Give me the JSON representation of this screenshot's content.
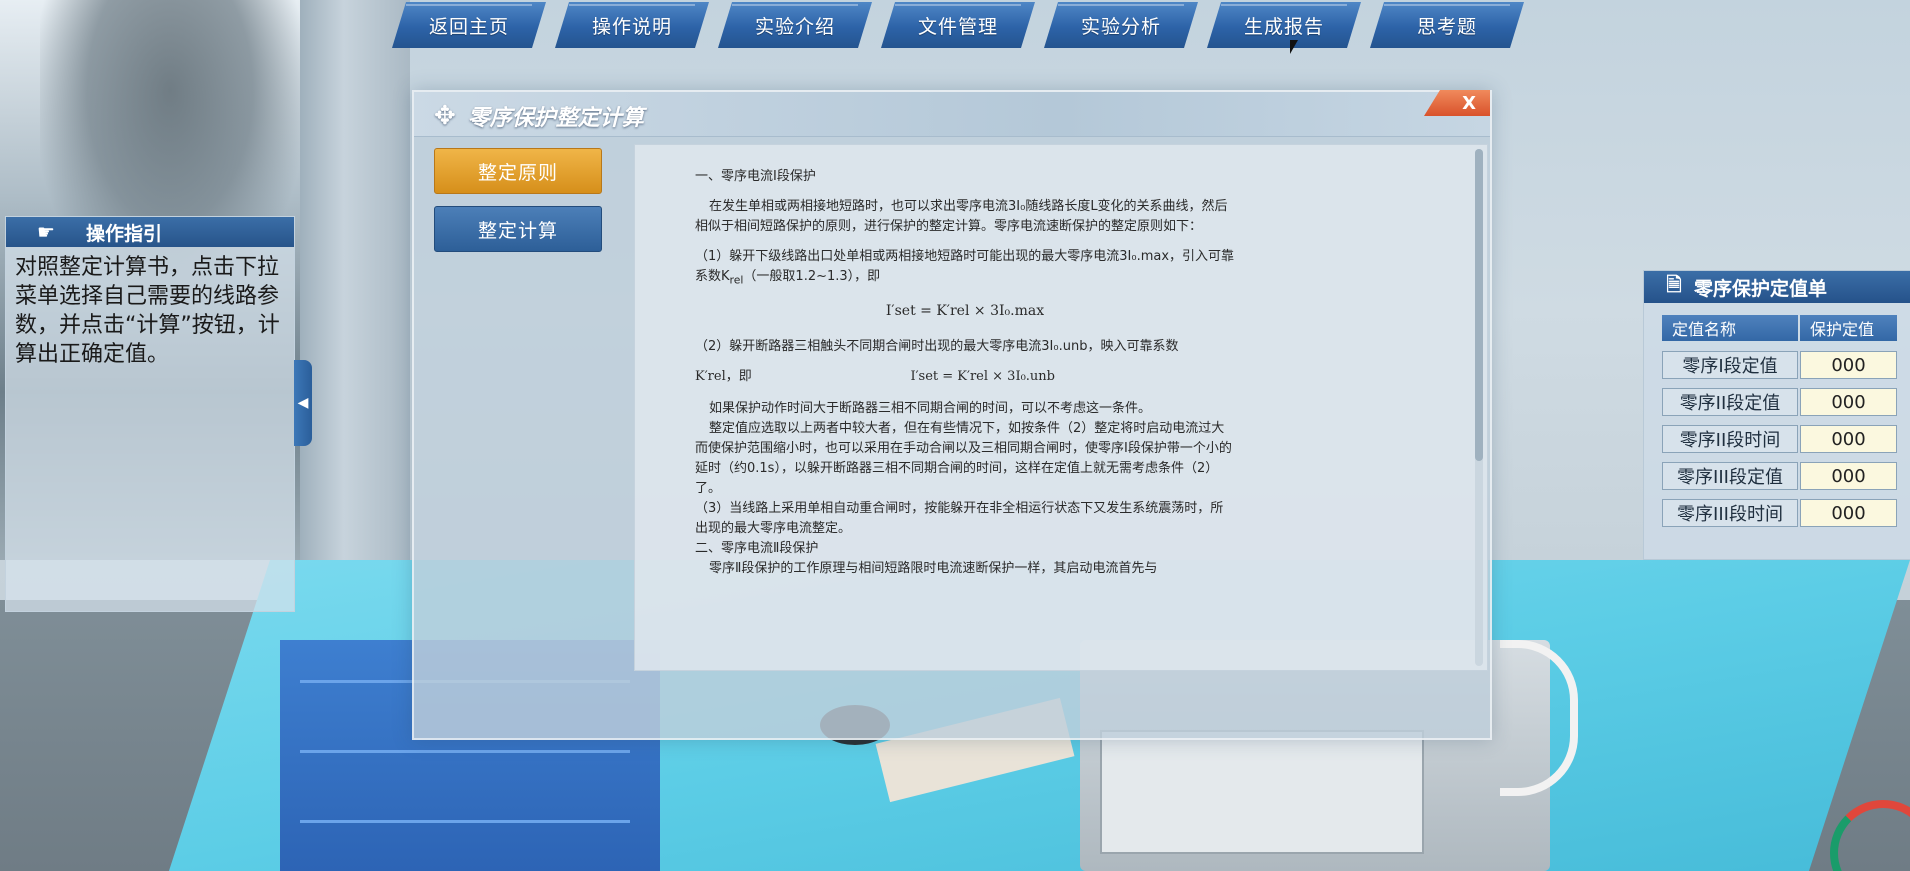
{
  "nav": [
    "返回主页",
    "操作说明",
    "实验介绍",
    "文件管理",
    "实验分析",
    "生成报告",
    "思考题"
  ],
  "guide": {
    "title": "操作指引",
    "text": "对照整定计算书，点击下拉菜单选择自己需要的线路参数，并点击“计算”按钮，计算出正确定值。"
  },
  "dialog": {
    "title": "零序保护整定计算",
    "close_label": "X",
    "buttons": [
      "整定原则",
      "整定计算"
    ],
    "active_button_index": 0,
    "doc": {
      "h1": "一、零序电流Ⅰ段保护",
      "p1": "在发生单相或两相接地短路时，也可以求出零序电流3I₀随线路长度L变化的关系曲线，然后相似于相间短路保护的原则，进行保护的整定计算。零序电流速断保护的整定原则如下：",
      "p2": "（1）躲开下级线路出口处单相或两相接地短路时可能出现的最大零序电流3I₀.max，引入可靠系数K<sub>rel</sub>（一般取1.2~1.3），即",
      "f1": "I′set = K′rel × 3I₀.max",
      "p3": "（2）躲开断路器三相触头不同期合闸时出现的最大零序电流3I₀.unb，映入可靠系数",
      "f2_left": "K′rel，即",
      "f2_right": "I′set = K′rel × 3I₀.unb",
      "p4": "如果保护动作时间大于断路器三相不同期合闸的时间，可以不考虑这一条件。",
      "p5": "整定值应选取以上两者中较大者，但在有些情况下，如按条件（2）整定将时启动电流过大而使保护范围缩小时，也可以采用在手动合闸以及三相同期合闸时，使零序Ⅰ段保护带一个小的延时（约0.1s），以躲开断路器三相不同期合闸的时间，这样在定值上就无需考虑条件（2）了。",
      "p6": "（3）当线路上采用单相自动重合闸时，按能躲开在非全相运行状态下又发生系统震荡时，所出现的最大零序电流整定。",
      "h2": "二、零序电流Ⅱ段保护",
      "p7": "零序Ⅱ段保护的工作原理与相间短路限时电流速断保护一样，其启动电流首先与"
    }
  },
  "sheet": {
    "title": "零序保护定值单",
    "headers": [
      "定值名称",
      "保护定值"
    ],
    "rows": [
      {
        "name": "零序I段定值",
        "value": "000"
      },
      {
        "name": "零序II段定值",
        "value": "000"
      },
      {
        "name": "零序II段时间",
        "value": "000"
      },
      {
        "name": "零序III段定值",
        "value": "000"
      },
      {
        "name": "零序III段时间",
        "value": "000"
      }
    ]
  }
}
